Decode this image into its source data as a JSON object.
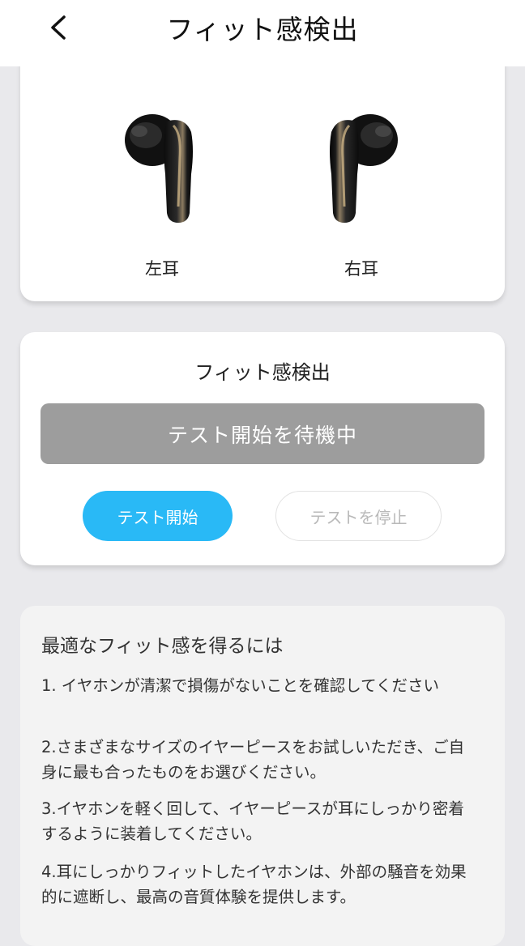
{
  "header": {
    "back_icon": "chevron-left-icon",
    "title": "フィット感検出"
  },
  "ear_card": {
    "left_label": "左耳",
    "right_label": "右耳"
  },
  "detection": {
    "title": "フィット感検出",
    "status": "テスト開始を待機中",
    "start_label": "テスト開始",
    "stop_label": "テストを停止",
    "colors": {
      "accent": "#29b9f6",
      "status_bg": "#9d9d9d"
    }
  },
  "tips": {
    "title": "最適なフィット感を得るには",
    "items": [
      "1. イヤホンが清潔で損傷がないことを確認してください",
      "2.さまざまなサイズのイヤーピースをお試しいただき、ご自身に最も合ったものをお選びください。",
      "3.イヤホンを軽く回して、イヤーピースが耳にしっかり密着するように装着してください。",
      "4.耳にしっかりフィットしたイヤホンは、外部の騒音を効果的に遮断し、最高の音質体験を提供します。"
    ]
  }
}
